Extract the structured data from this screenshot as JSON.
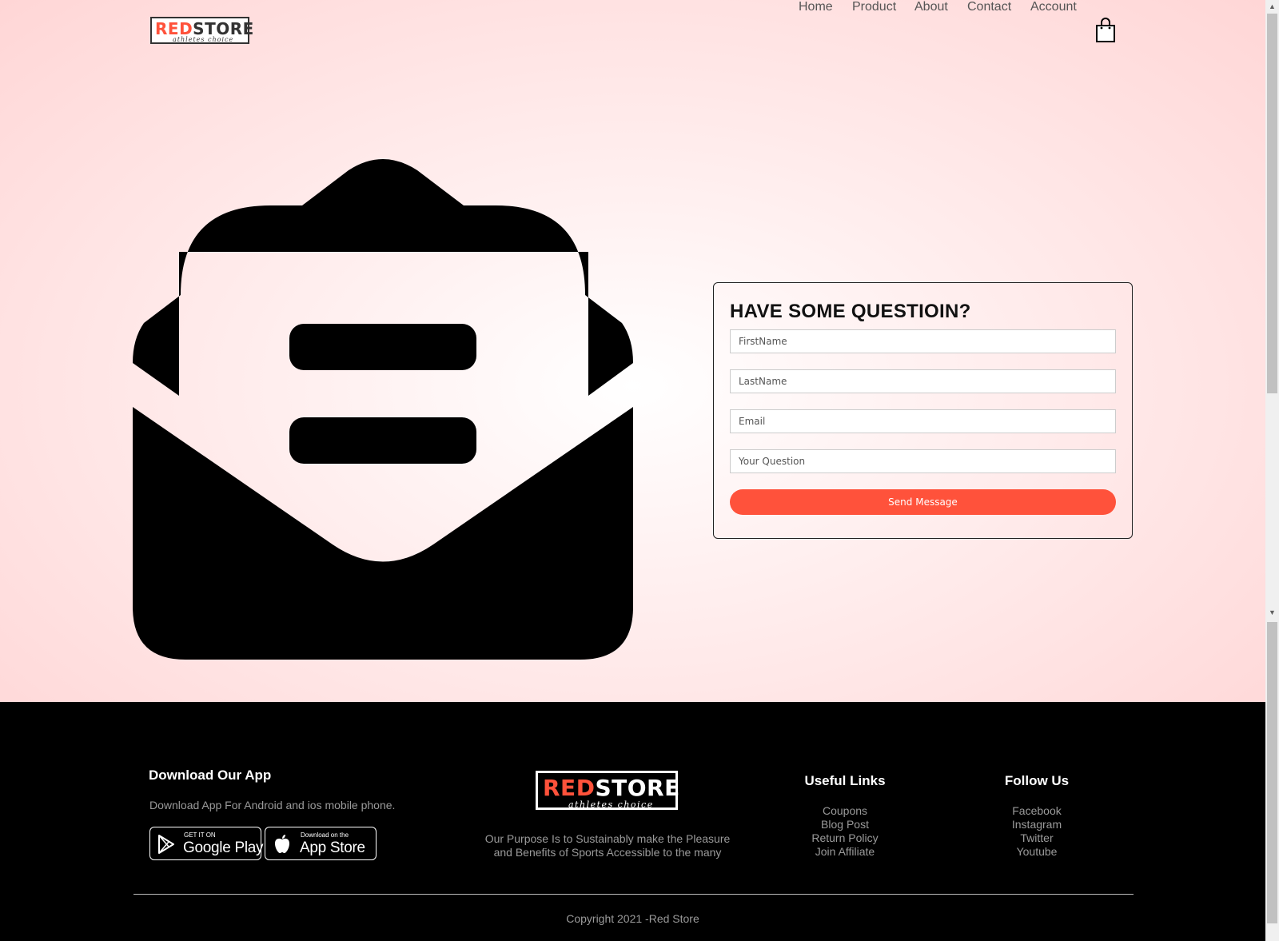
{
  "brand": {
    "logo_red": "RED",
    "logo_dark": "STORE",
    "tagline": "athletes choice"
  },
  "nav": {
    "items": [
      "Home",
      "Product",
      "About",
      "Contact",
      "Account"
    ]
  },
  "form": {
    "title": "HAVE SOME QUESTIOIN?",
    "first_name_placeholder": "FirstName",
    "last_name_placeholder": "LastName",
    "email_placeholder": "Email",
    "question_placeholder": "Your Question",
    "submit_label": "Send Message"
  },
  "footer": {
    "app": {
      "heading": "Download Our App",
      "text": "Download App For Android and ios mobile phone.",
      "google_small": "GET IT ON",
      "google_big": "Google Play",
      "apple_small": "Download on the",
      "apple_big": "App Store"
    },
    "about": {
      "line1": "Our Purpose Is to Sustainably make the Pleasure",
      "line2": "and Benefits of Sports Accessible to the many"
    },
    "useful_links": {
      "heading": "Useful Links",
      "items": [
        "Coupons",
        "Blog Post",
        "Return Policy",
        "Join Affiliate"
      ]
    },
    "follow": {
      "heading": "Follow Us",
      "items": [
        "Facebook",
        "Instagram",
        "Twitter",
        "Youtube"
      ]
    },
    "copyright": "Copyright 2021 -Red Store"
  },
  "colors": {
    "accent": "#ff523b",
    "footer_bg": "#000000"
  },
  "icons": [
    "cart-icon",
    "mail-open-icon",
    "google-play-icon",
    "apple-icon"
  ]
}
